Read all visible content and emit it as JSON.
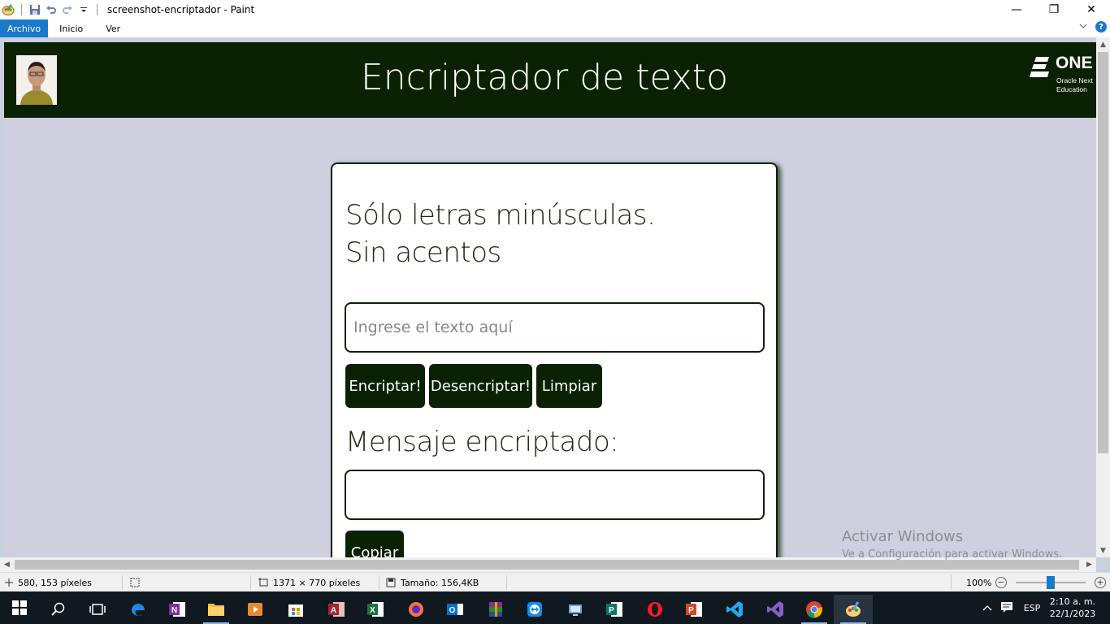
{
  "window": {
    "title": "screenshot-encriptador - Paint",
    "minimize": "—",
    "restore": "❐",
    "close": "✕"
  },
  "ribbon": {
    "tabs": [
      {
        "label": "Archivo",
        "active": true
      },
      {
        "label": "Inicio",
        "active": false
      },
      {
        "label": "Ver",
        "active": false
      }
    ],
    "help": "?"
  },
  "webpage": {
    "header_title": "Encriptador de texto",
    "logo_word": "ONE",
    "logo_sub_line1": "Oracle Next",
    "logo_sub_line2": "Education",
    "instructions_line1": "Sólo letras minúsculas.",
    "instructions_line2": "Sin acentos",
    "input_placeholder": "Ingrese el texto aquí",
    "buttons": {
      "encrypt": "Encriptar!",
      "decrypt": "Desencriptar!",
      "clear": "Limpiar"
    },
    "output_heading": "Mensaje encriptado:",
    "output_value": "",
    "copy_button": "Copiar",
    "colors": {
      "dark_green": "#0a2103",
      "page_background": "#cfcfdf",
      "white": "#ffffff"
    }
  },
  "watermark": {
    "line1": "Activar Windows",
    "line2": "Ve a Configuración para activar Windows."
  },
  "statusbar": {
    "cursor_position": "580, 153 píxeles",
    "image_dimensions": "1371 × 770 píxeles",
    "file_size": "Tamaño: 156,4KB",
    "zoom": "100%",
    "zoom_fraction": 0.5
  },
  "taskbar": {
    "language": "ESP",
    "time": "2:10 a. m.",
    "date": "22/1/2023",
    "apps": [
      "start",
      "search",
      "task-view",
      "edge",
      "onenote",
      "file-explorer",
      "media-player",
      "store",
      "access",
      "excel",
      "firefox",
      "outlook",
      "winrar",
      "teamviewer",
      "network-app",
      "publisher",
      "opera",
      "powerpoint",
      "vscode",
      "visual-studio",
      "chrome",
      "paint"
    ]
  }
}
